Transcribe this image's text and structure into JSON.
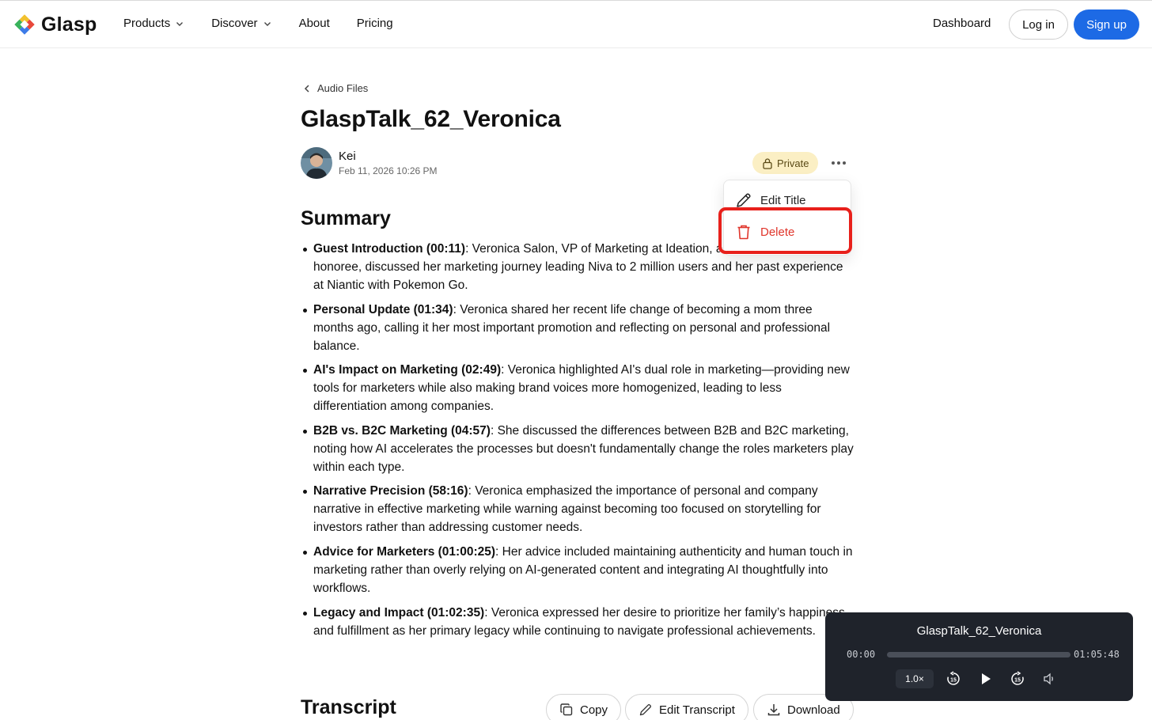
{
  "header": {
    "brand": "Glasp",
    "nav": [
      {
        "label": "Products",
        "has_dropdown": true
      },
      {
        "label": "Discover",
        "has_dropdown": true
      },
      {
        "label": "About",
        "has_dropdown": false
      },
      {
        "label": "Pricing",
        "has_dropdown": false
      }
    ],
    "dashboard_label": "Dashboard",
    "login_label": "Log in",
    "signup_label": "Sign up",
    "accent_color": "#1d6ae5"
  },
  "page": {
    "breadcrumb": "Audio Files",
    "title": "GlaspTalk_62_Veronica",
    "author": {
      "name": "Kei",
      "date": "Feb 11, 2026 10:26 PM"
    },
    "visibility_label": "Private",
    "menu": {
      "edit_label": "Edit Title",
      "delete_label": "Delete",
      "delete_color": "#e0352b"
    }
  },
  "summary": {
    "heading": "Summary",
    "items": [
      {
        "bold": "Guest Introduction (00:11)",
        "text": ": Veronica Salon, VP of Marketing at Ideation, a Forbes 30 Under 30 honoree, discussed her marketing journey leading Niva to 2 million users and her past experience at Niantic with Pokemon Go."
      },
      {
        "bold": "Personal Update (01:34)",
        "text": ": Veronica shared her recent life change of becoming a mom three months ago, calling it her most important promotion and reflecting on personal and professional balance."
      },
      {
        "bold": "AI's Impact on Marketing (02:49)",
        "text": ": Veronica highlighted AI's dual role in marketing—providing new tools for marketers while also making brand voices more homogenized, leading to less differentiation among companies."
      },
      {
        "bold": "B2B vs. B2C Marketing (04:57)",
        "text": ": She discussed the differences between B2B and B2C marketing, noting how AI accelerates the processes but doesn't fundamentally change the roles marketers play within each type."
      },
      {
        "bold": "Narrative Precision (58:16)",
        "text": ": Veronica emphasized the importance of personal and company narrative in effective marketing while warning against becoming too focused on storytelling for investors rather than addressing customer needs."
      },
      {
        "bold": "Advice for Marketers (01:00:25)",
        "text": ": Her advice included maintaining authenticity and human touch in marketing rather than overly relying on AI-generated content and integrating AI thoughtfully into workflows."
      },
      {
        "bold": "Legacy and Impact (01:02:35)",
        "text": ": Veronica expressed her desire to prioritize her family’s happiness and fulfillment as her primary legacy while continuing to navigate professional achievements."
      }
    ]
  },
  "transcript": {
    "heading": "Transcript",
    "copy_label": "Copy",
    "edit_label": "Edit Transcript",
    "download_label": "Download"
  },
  "player": {
    "title": "GlaspTalk_62_Veronica",
    "current_time": "00:00",
    "duration": "01:05:48",
    "speed": "1.0×",
    "progress": 0
  }
}
